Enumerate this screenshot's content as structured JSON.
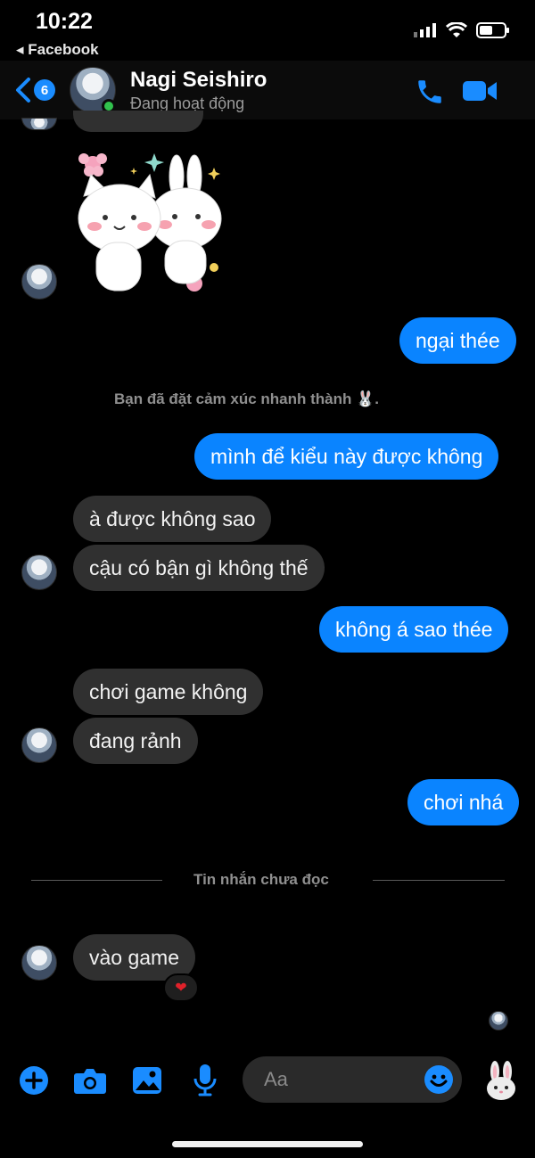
{
  "status_bar": {
    "time": "10:22",
    "back_app": "◂ Facebook"
  },
  "header": {
    "back_badge": "6",
    "name": "Nagi Seishiro",
    "status": "Đang hoạt động"
  },
  "messages": [
    {
      "side": "out",
      "text": "ngại thée"
    },
    {
      "side": "system",
      "text": "Bạn đã đặt cảm xúc nhanh thành 🐰."
    },
    {
      "side": "out",
      "text": "mình để kiểu này được không"
    },
    {
      "side": "in",
      "text": "à được không sao"
    },
    {
      "side": "in",
      "text": "cậu có bận gì không thế"
    },
    {
      "side": "out",
      "text": "không á sao thée"
    },
    {
      "side": "in",
      "text": "chơi game không"
    },
    {
      "side": "in",
      "text": "đang rảnh"
    },
    {
      "side": "out",
      "text": "chơi nhá"
    },
    {
      "side": "in",
      "text": "vào game",
      "reaction": "❤"
    }
  ],
  "unread_divider": "Tin nhắn chưa đọc",
  "composer": {
    "placeholder": "Aa"
  },
  "icons": {
    "toolbar": [
      "plus-icon",
      "camera-icon",
      "image-icon",
      "mic-icon",
      "emoji-icon",
      "bunny-quick-reaction-icon"
    ]
  },
  "colors": {
    "outgoing": "#0a84ff",
    "incoming": "#303030",
    "accent": "#1a8cff"
  }
}
